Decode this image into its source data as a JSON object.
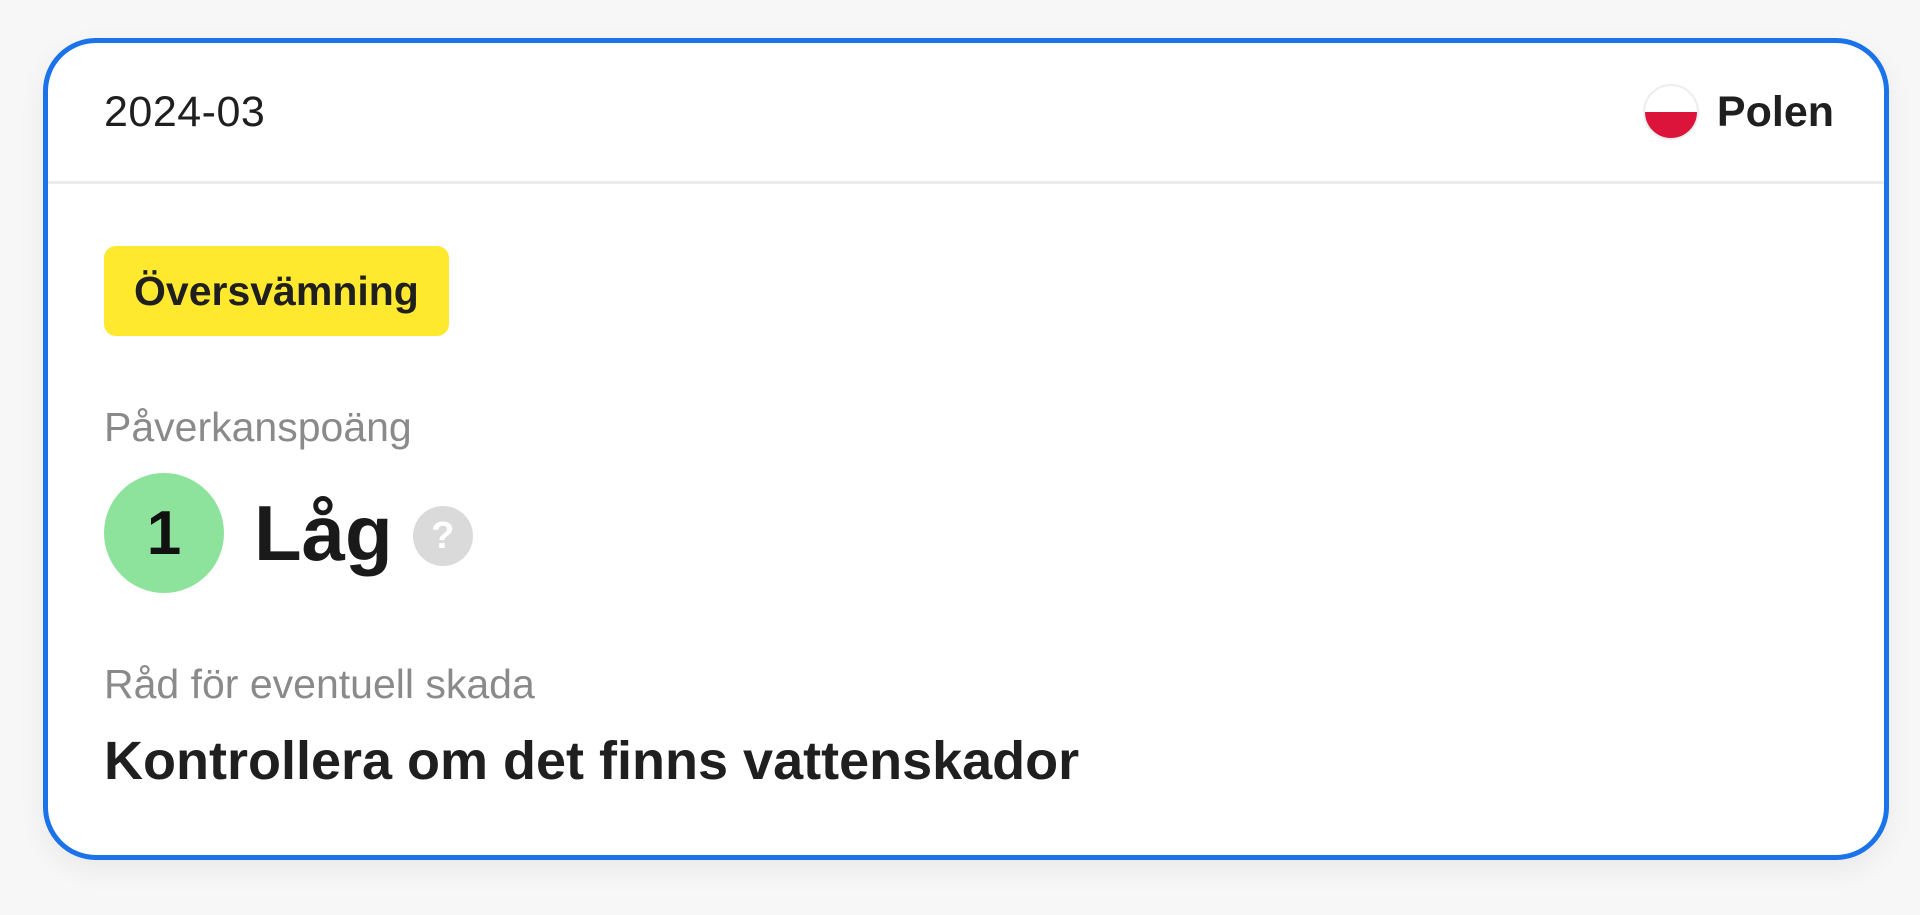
{
  "card": {
    "date": "2024-03",
    "country": {
      "name": "Polen",
      "flag_icon": "poland-flag-icon",
      "flag_colors": [
        "#ffffff",
        "#dc143c"
      ]
    },
    "tag": {
      "label": "Översvämning",
      "color": "#ffe92e"
    },
    "score": {
      "label": "Påverkanspoäng",
      "value": "1",
      "level": "Låg",
      "color": "#8ee39c",
      "help_icon": "question-mark-icon",
      "help_glyph": "?"
    },
    "advice": {
      "label": "Råd för eventuell skada",
      "text": "Kontrollera om det finns vattenskador"
    },
    "accent_color": "#1a73e8"
  }
}
